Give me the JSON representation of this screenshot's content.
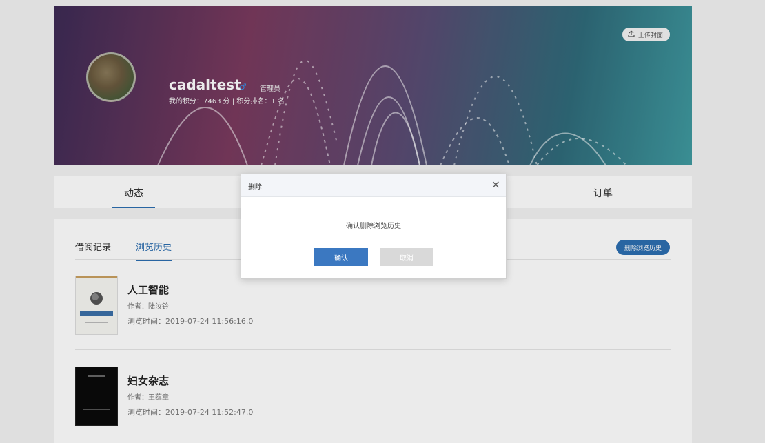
{
  "profile": {
    "username": "cadaltest",
    "gender_icon": "male-icon",
    "role": "管理员",
    "points_text": "我的积分：7463 分 | 积分排名：1 名",
    "upload_cover_label": "上传封面"
  },
  "tabs": [
    {
      "label": "动态"
    },
    {
      "label": "订单"
    }
  ],
  "subtabs": [
    {
      "label": "借阅记录"
    },
    {
      "label": "浏览历史"
    }
  ],
  "delete_history_label": "删除浏览历史",
  "books": [
    {
      "title": "人工智能",
      "author": "作者：陆汝钤",
      "time": "浏览时间：2019-07-24 11:56:16.0"
    },
    {
      "title": "妇女杂志",
      "author": "作者：王蕴章",
      "time": "浏览时间：2019-07-24 11:52:47.0"
    }
  ],
  "dialog": {
    "title": "删除",
    "message": "确认删除浏览历史",
    "confirm_label": "确认",
    "cancel_label": "取消",
    "close_glyph": "×"
  },
  "colors": {
    "accent": "#2c6eb0",
    "confirm_button": "#3b78c1",
    "cancel_button": "#d9d9d9"
  }
}
